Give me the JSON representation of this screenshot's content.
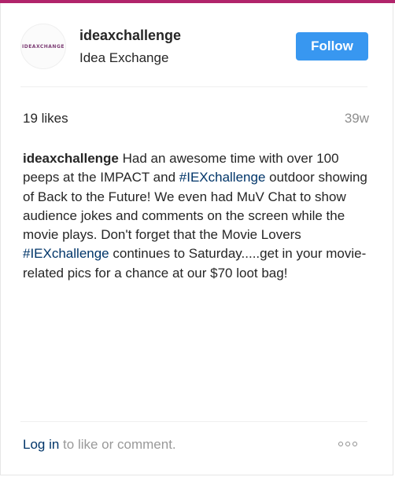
{
  "post": {
    "avatar_text": "IDEAXCHANGE",
    "username": "ideaxchallenge",
    "subtitle": "Idea Exchange",
    "follow_label": "Follow",
    "likes": "19 likes",
    "time": "39w",
    "caption": {
      "user": "ideaxchallenge",
      "text1": " Had an awesome time with over 100 peeps at the IMPACT and ",
      "hashtag1": "#IEXchallenge",
      "text2": " outdoor showing of Back to the Future! We even had MuV Chat to show audience jokes and comments on the screen while the movie plays. Don't forget that the Movie Lovers ",
      "hashtag2": "#IEXchallenge",
      "text3": " continues to Saturday.....get in your movie-related pics for a chance at our $70 loot bag!"
    },
    "login_link": "Log in",
    "comment_prompt": " to like or comment."
  },
  "colors": {
    "follow_button": "#3897f0",
    "link": "#003569",
    "top_strip": "#b1246b"
  }
}
